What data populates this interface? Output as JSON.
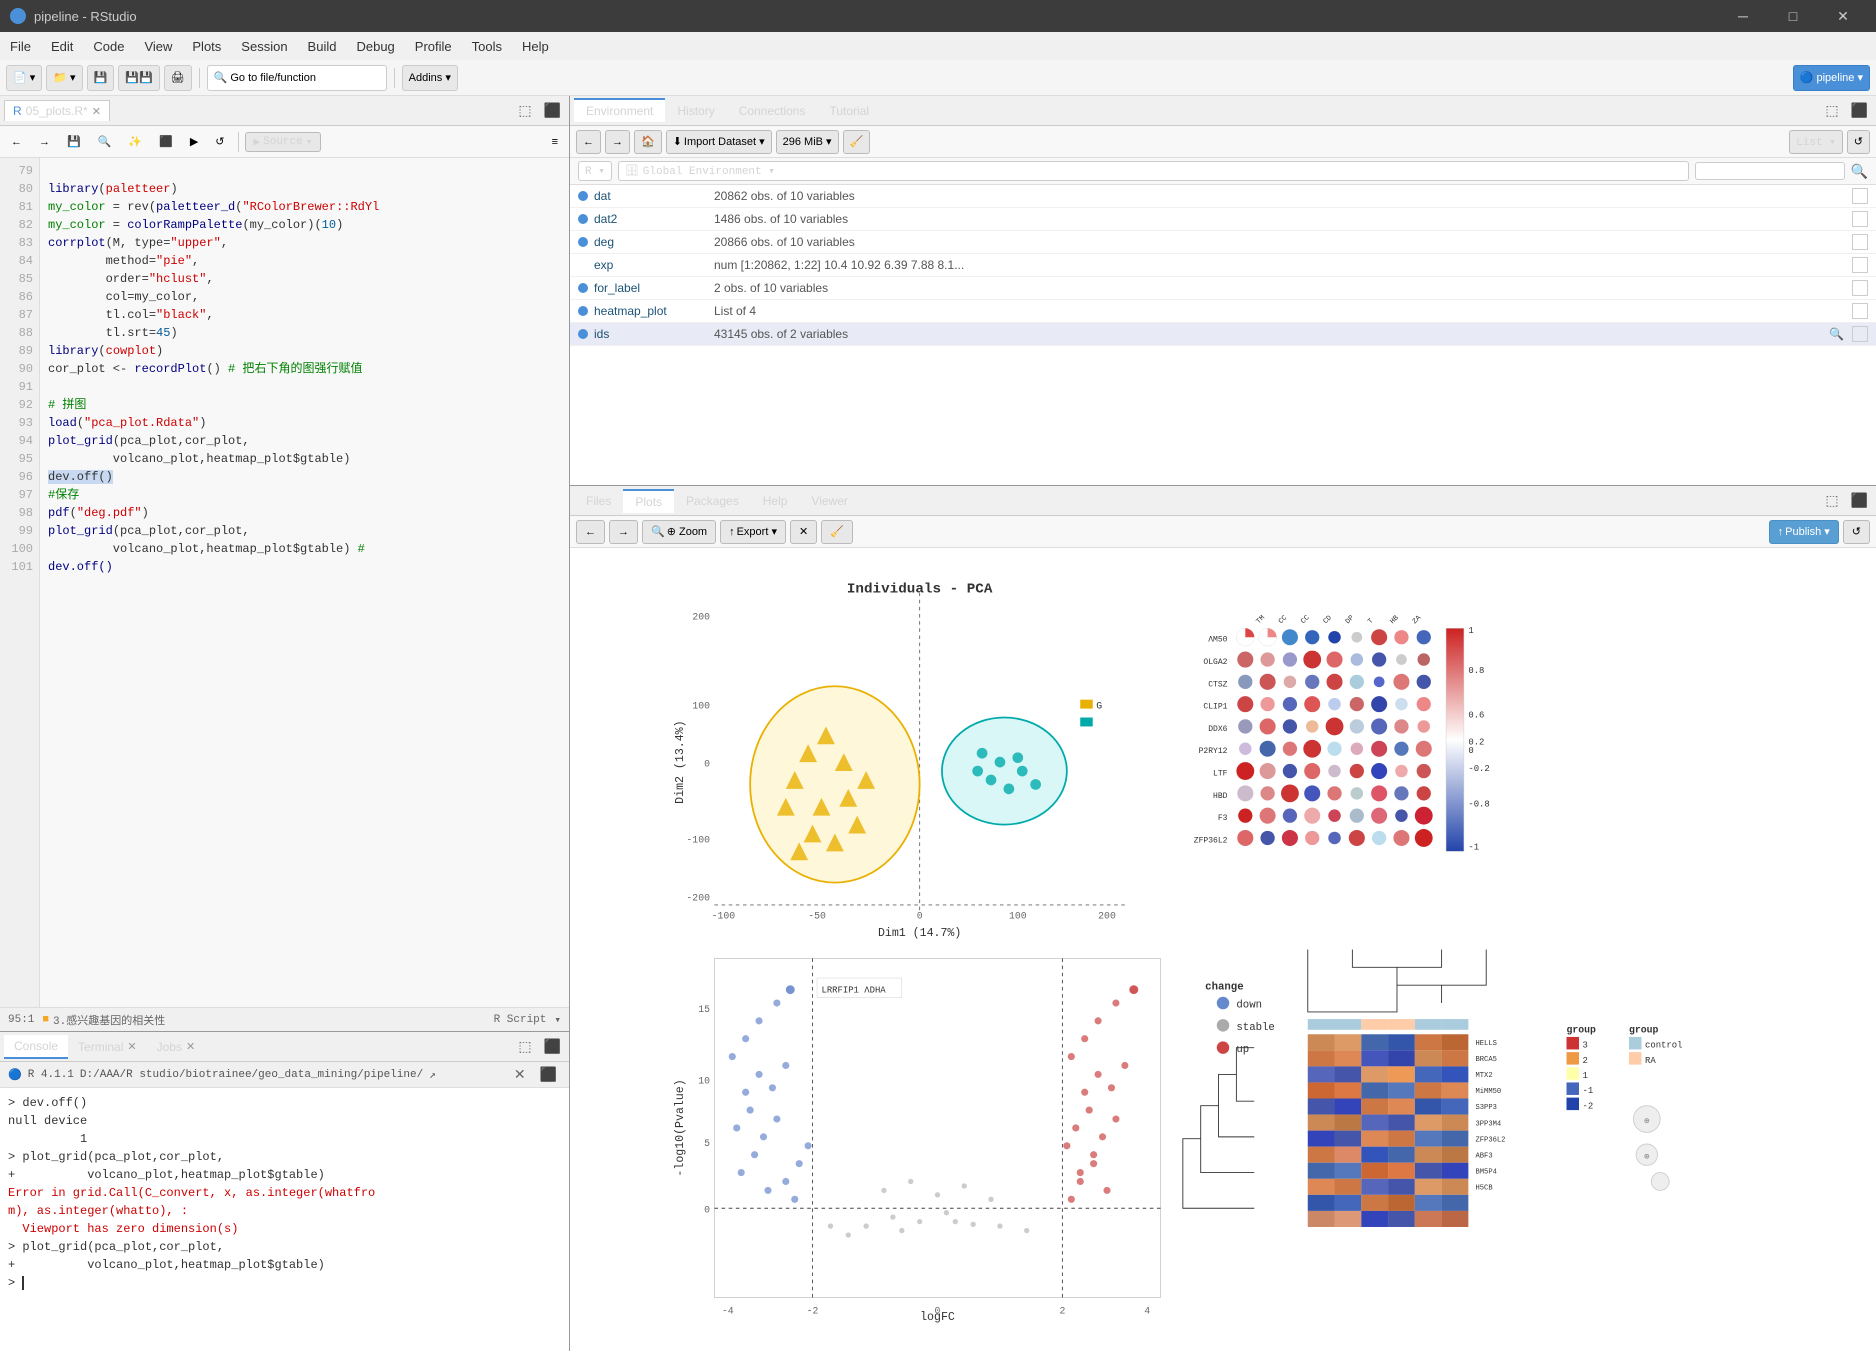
{
  "titlebar": {
    "title": "pipeline - RStudio",
    "icon": "●",
    "minimize": "─",
    "maximize": "□",
    "close": "✕"
  },
  "menubar": {
    "items": [
      "File",
      "Edit",
      "Code",
      "View",
      "Plots",
      "Session",
      "Build",
      "Debug",
      "Profile",
      "Tools",
      "Help"
    ]
  },
  "toolbar": {
    "addins": "Addins ▾",
    "go_to": "Go to file/function",
    "pipeline": "pipeline ▾"
  },
  "editor": {
    "tab_name": "05_plots.R",
    "tab_modified": true,
    "source_label": "Source",
    "source_dropdown": "▾",
    "lines": [
      {
        "num": 79,
        "content": "library(paletteer)"
      },
      {
        "num": 80,
        "content": "my_color = rev(paletteer_d(\"RColorBrewer::RdYl",
        "truncated": true
      },
      {
        "num": 81,
        "content": "my_color = colorRampPalette(my_color)(10)"
      },
      {
        "num": 82,
        "content": "corrplot(M, type=\"upper\","
      },
      {
        "num": 83,
        "content": "        method=\"pie\","
      },
      {
        "num": 84,
        "content": "        order=\"hclust\","
      },
      {
        "num": 85,
        "content": "        col=my_color,"
      },
      {
        "num": 86,
        "content": "        tl.col=\"black\","
      },
      {
        "num": 87,
        "content": "        tl.srt=45)"
      },
      {
        "num": 88,
        "content": "library(cowplot)"
      },
      {
        "num": 89,
        "content": "cor_plot <- recordPlot() # 把右下角的图强行赋值"
      },
      {
        "num": 90,
        "content": ""
      },
      {
        "num": 91,
        "content": "# 拼图"
      },
      {
        "num": 92,
        "content": "load(\"pca_plot.Rdata\")"
      },
      {
        "num": 93,
        "content": "plot_grid(pca_plot,cor_plot,"
      },
      {
        "num": 94,
        "content": "         volcano_plot,heatmap_plot$gtable)"
      },
      {
        "num": 95,
        "content": "dev.off()"
      },
      {
        "num": 96,
        "content": "#保存"
      },
      {
        "num": 97,
        "content": "pdf(\"deg.pdf\")"
      },
      {
        "num": 98,
        "content": "plot_grid(pca_plot,cor_plot,"
      },
      {
        "num": 99,
        "content": "         volcano_plot,heatmap_plot$gtable) #"
      },
      {
        "num": 100,
        "content": "dev.off()"
      },
      {
        "num": 101,
        "content": ""
      }
    ],
    "cursor": "95:1",
    "section": "3.感兴趣基因的相关性",
    "script_type": "R Script"
  },
  "environment_panel": {
    "tabs": [
      "Environment",
      "History",
      "Connections",
      "Tutorial"
    ],
    "active_tab": "Environment",
    "toolbar": {
      "import_dataset": "Import Dataset ▾",
      "memory": "296 MiB ▾",
      "list_view": "List ▾",
      "refresh": "↺"
    },
    "r_selector": "R ▾",
    "env_selector": "Global Environment ▾",
    "search_placeholder": "",
    "variables": [
      {
        "name": "dat",
        "value": "20862 obs. of 10 variables",
        "color": "#4a90d9"
      },
      {
        "name": "dat2",
        "value": "1486 obs. of 10 variables",
        "color": "#4a90d9"
      },
      {
        "name": "deg",
        "value": "20866 obs. of 10 variables",
        "color": "#4a90d9"
      },
      {
        "name": "exp",
        "value": "num [1:20862, 1:22] 10.4 10.92 6.39 7.88 8.1...",
        "color": null
      },
      {
        "name": "for_label",
        "value": "2 obs. of 10 variables",
        "color": "#4a90d9"
      },
      {
        "name": "heatmap_plot",
        "value": "List of 4",
        "color": "#4a90d9"
      },
      {
        "name": "ids",
        "value": "43145 obs. of 2 variables",
        "color": "#4a90d9"
      }
    ]
  },
  "plots_panel": {
    "tabs": [
      "Files",
      "Plots",
      "Packages",
      "Help",
      "Viewer"
    ],
    "active_tab": "Plots",
    "toolbar": {
      "back": "←",
      "forward": "→",
      "zoom": "⊕ Zoom",
      "export": "↑ Export ▾",
      "delete": "✕",
      "broom": "🧹",
      "publish": "↑ Publish ▾",
      "refresh": "↺"
    }
  },
  "console": {
    "tabs": [
      "Console",
      "Terminal",
      "Jobs"
    ],
    "active_tab": "Console",
    "r_version": "R 4.1.1",
    "working_dir": "D:/AAA/R studio/biotrainee/geo_data_mining/pipeline/",
    "content": [
      "> dev.off()",
      "null device",
      "          1",
      "> plot_grid(pca_plot,cor_plot,",
      "+          volcano_plot,heatmap_plot$gtable)",
      "Error in grid.Call(C_convert, x, as.integer(whatfro",
      "m), as.integer(whatto), :",
      "  Viewport has zero dimension(s)",
      "> plot_grid(pca_plot,cor_plot,",
      "+          volcano_plot,heatmap_plot$gtable)",
      "> "
    ]
  },
  "colors": {
    "accent": "#4a90d9",
    "error": "#cc0000",
    "tab_active": "#ffffff",
    "panel_bg": "#f0f0f0",
    "code_bg": "#f8f8f8"
  }
}
